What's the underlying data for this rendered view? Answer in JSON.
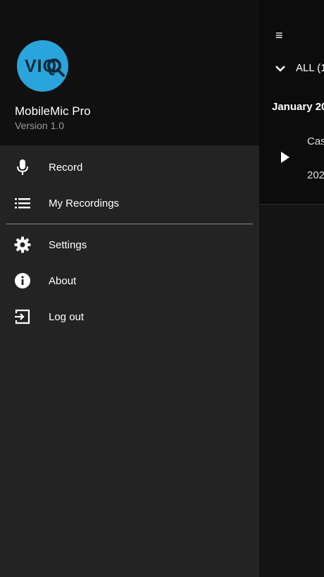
{
  "background": {
    "filter_label": "ALL (1",
    "date_header": "January 20",
    "recording_title": "Cas",
    "recording_date": "202"
  },
  "drawer": {
    "logo_text": "VIQ",
    "app_name": "MobileMic Pro",
    "version": "Version 1.0",
    "items": [
      {
        "label": "Record",
        "icon": "microphone-icon"
      },
      {
        "label": "My Recordings",
        "icon": "list-icon"
      },
      {
        "label": "Settings",
        "icon": "gear-icon"
      },
      {
        "label": "About",
        "icon": "info-icon"
      },
      {
        "label": "Log out",
        "icon": "logout-icon"
      }
    ]
  },
  "colors": {
    "logo": "#2aa4dc",
    "drawer_bg": "#232323",
    "header_bg": "#101010"
  }
}
